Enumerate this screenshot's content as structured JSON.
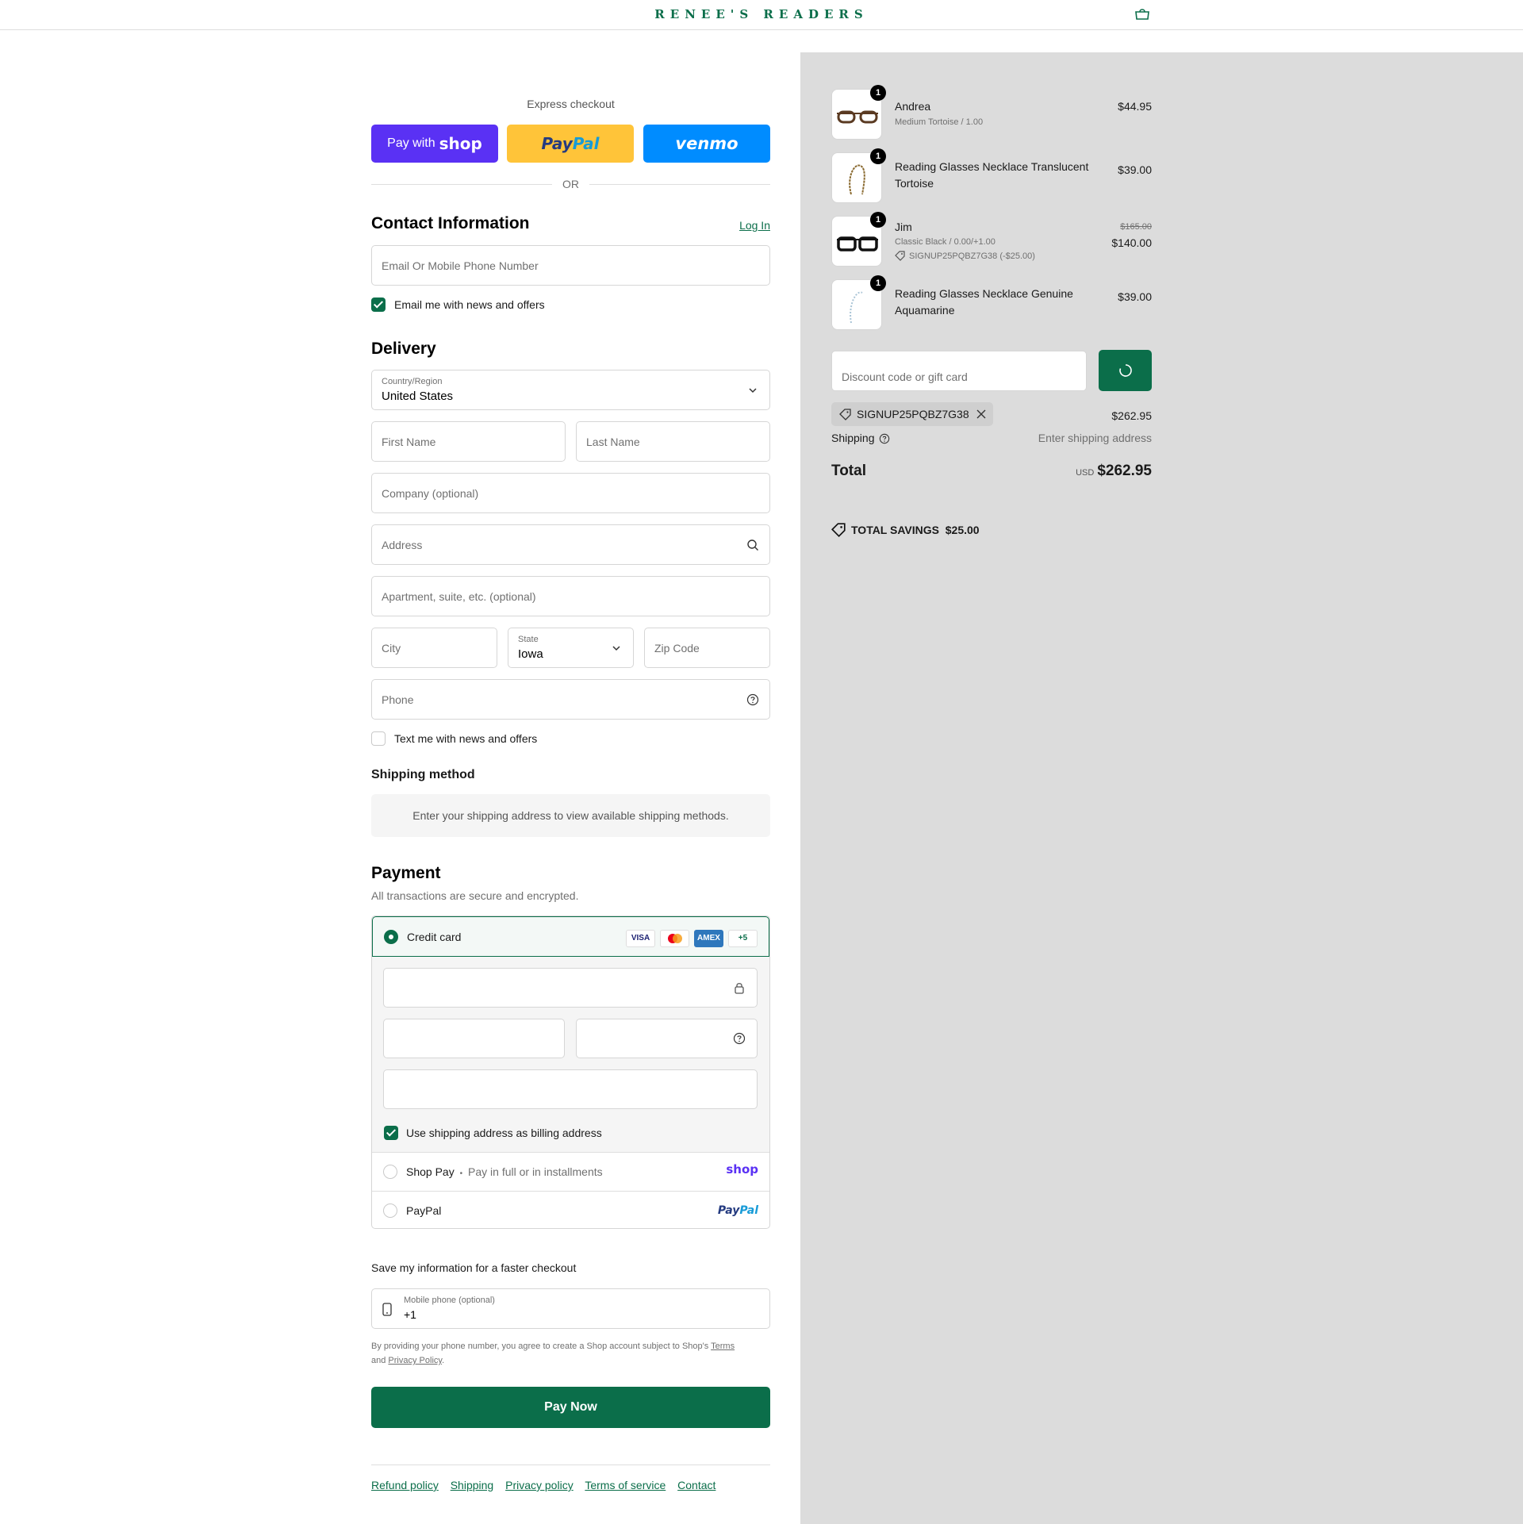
{
  "header": {
    "logo": "RENEE'S READERS",
    "cart_icon": "bag-icon"
  },
  "express": {
    "label": "Express checkout",
    "shop_prefix": "Pay with",
    "shop_brand": "shop",
    "paypal_pay": "Pay",
    "paypal_pal": "Pal",
    "venmo": "venmo",
    "or": "OR"
  },
  "contact": {
    "title": "Contact Information",
    "login": "Log In",
    "email_placeholder": "Email Or Mobile Phone Number",
    "email_news_checked": true,
    "email_news_label": "Email me with news and offers"
  },
  "delivery": {
    "title": "Delivery",
    "country_label": "Country/Region",
    "country_value": "United States",
    "first_name_placeholder": "First Name",
    "last_name_placeholder": "Last Name",
    "company_placeholder": "Company (optional)",
    "address_placeholder": "Address",
    "apartment_placeholder": "Apartment, suite, etc. (optional)",
    "city_placeholder": "City",
    "state_label": "State",
    "state_value": "Iowa",
    "zip_placeholder": "Zip Code",
    "phone_placeholder": "Phone",
    "text_news_checked": false,
    "text_news_label": "Text me with news and offers"
  },
  "shipping_method": {
    "title": "Shipping method",
    "message": "Enter your shipping address to view available shipping methods."
  },
  "payment": {
    "title": "Payment",
    "subtitle": "All transactions are secure and encrypted.",
    "credit_card_label": "Credit card",
    "card_brands": [
      "VISA",
      "",
      "AMEX",
      "+5"
    ],
    "billing_same_checked": true,
    "billing_same_label": "Use shipping address as billing address",
    "shop_pay_label": "Shop Pay",
    "shop_pay_sep": "•",
    "shop_pay_sub": "Pay in full or in installments",
    "shop_pay_brand": "shop",
    "paypal_label": "PayPal",
    "paypal_brand_pay": "Pay",
    "paypal_brand_pal": "Pal"
  },
  "save_info": {
    "title": "Save my information for a faster checkout",
    "mobile_label": "Mobile phone (optional)",
    "mobile_value": "+1",
    "fine_1": "By providing your phone number, you agree to create a Shop account subject to Shop's",
    "terms": "Terms",
    "fine_and": "and",
    "privacy": "Privacy Policy",
    "fine_end": "."
  },
  "pay_now": "Pay Now",
  "footer": [
    "Refund policy",
    "Shipping",
    "Privacy policy",
    "Terms of service",
    "Contact"
  ],
  "summary": {
    "items": [
      {
        "qty": "1",
        "name": "Andrea",
        "variant": "Medium Tortoise / 1.00",
        "price": "$44.95"
      },
      {
        "qty": "1",
        "name": "Reading Glasses Necklace Translucent Tortoise",
        "price": "$39.00"
      },
      {
        "qty": "1",
        "name": "Jim",
        "variant": "Classic Black / 0.00/+1.00",
        "discount": "SIGNUP25PQBZ7G38 (-$25.00)",
        "original_price": "$165.00",
        "price": "$140.00"
      },
      {
        "qty": "1",
        "name": "Reading Glasses Necklace Genuine Aquamarine",
        "price": "$39.00"
      }
    ],
    "discount_placeholder": "Discount code or gift card",
    "applied_code": "SIGNUP25PQBZ7G38",
    "subtotal": "$262.95",
    "shipping_label": "Shipping",
    "shipping_value": "Enter shipping address",
    "total_label": "Total",
    "currency": "USD",
    "total": "$262.95",
    "savings_label": "TOTAL SAVINGS",
    "savings_value": "$25.00"
  },
  "colors": {
    "brand_green": "#0b6e4a",
    "shop_purple": "#5a31f4",
    "paypal_yellow": "#ffc439",
    "venmo_blue": "#008cff",
    "summary_bg": "#dcdcdc"
  }
}
